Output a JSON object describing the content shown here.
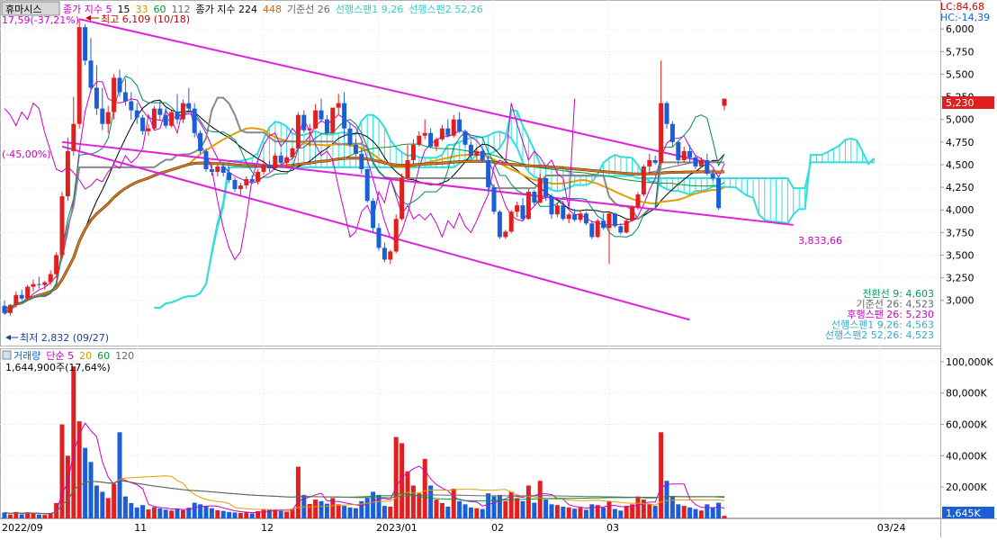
{
  "stock_name": "휴마시스",
  "header_legend": [
    {
      "text": "종가 지수 5",
      "color": "#cc00cc"
    },
    {
      "text": "15",
      "color": "#000000"
    },
    {
      "text": "33",
      "color": "#cc9900"
    },
    {
      "text": "60",
      "color": "#009933"
    },
    {
      "text": "112",
      "color": "#666666"
    },
    {
      "text": "종가 지수 224",
      "color": "#000000"
    },
    {
      "text": "448",
      "color": "#cc6600"
    },
    {
      "text": "기준선 26",
      "color": "#666666"
    },
    {
      "text": "선행스팬1 9,26",
      "color": "#33cccc"
    },
    {
      "text": "선행스팬2 52,26",
      "color": "#33cccc"
    }
  ],
  "top_left_info": "17,59(-37,21%)",
  "high_label": "최고 6,109 (10/18)",
  "low_label": "최저 2,832 (09/27)",
  "pct_label": "(-45,00%)",
  "trend_label": "3,833,66",
  "lc_label": "LC:84,68",
  "hc_label": "HC:-14,39",
  "current_price_label": "5,230",
  "current_volume_label": "1,645K",
  "ichimoku_values": [
    {
      "text": "전환선 9: 4,603",
      "color": "#009966"
    },
    {
      "text": "기준선 26: 4,523",
      "color": "#666666"
    },
    {
      "text": "후행스팬 26: 5,230",
      "color": "#cc00cc"
    },
    {
      "text": "선행스팬1 9,26: 4,563",
      "color": "#33aacc"
    },
    {
      "text": "선행스팬2 52,26: 4,523",
      "color": "#33aacc"
    }
  ],
  "volume_legend": [
    {
      "text": "거래량",
      "color": "#0066cc"
    },
    {
      "text": "단순 5",
      "color": "#cc00cc"
    },
    {
      "text": "20",
      "color": "#cc9900"
    },
    {
      "text": "60",
      "color": "#009933"
    },
    {
      "text": "120",
      "color": "#666666"
    }
  ],
  "volume_info": "1,644,900주(17,64%)",
  "colors": {
    "up": "#e02020",
    "down": "#1a5fd6",
    "cloud": "#33dddd",
    "trend": "#dd22dd"
  },
  "chart_data": {
    "type": "candlestick",
    "price_axis": {
      "ticks": [
        3000,
        3250,
        3500,
        3750,
        4000,
        4250,
        4500,
        4750,
        5000,
        5250,
        5500,
        5750,
        6000
      ],
      "tick_labels": [
        "3,000",
        "3,250",
        "3,500",
        "3,750",
        "4,000",
        "4,250",
        "4,500",
        "4,750",
        "5,000",
        "5,250",
        "5,500",
        "5,750",
        "6,000"
      ],
      "range": [
        2500,
        6300
      ]
    },
    "volume_axis": {
      "ticks": [
        20000000,
        40000000,
        60000000,
        80000000,
        100000000
      ],
      "tick_labels": [
        "20,000K",
        "40,000K",
        "60,000K",
        "80,000K",
        "100,000K"
      ],
      "range": [
        0,
        108000000
      ]
    },
    "x_axis_labels": [
      {
        "index": 0,
        "label": "2022/09"
      },
      {
        "index": 23,
        "label": "11"
      },
      {
        "index": 45,
        "label": "12"
      },
      {
        "index": 65,
        "label": "2023/01"
      },
      {
        "index": 85,
        "label": "02"
      },
      {
        "index": 105,
        "label": "03"
      },
      {
        "index": 152,
        "label": "03/24"
      }
    ],
    "bars": [
      [
        2940,
        3000,
        2840,
        2860,
        3800000
      ],
      [
        2860,
        2960,
        2832,
        2950,
        2500000
      ],
      [
        2950,
        3100,
        2920,
        3060,
        4100000
      ],
      [
        3060,
        3120,
        3000,
        3020,
        2600000
      ],
      [
        3020,
        3170,
        3000,
        3150,
        3900000
      ],
      [
        3150,
        3230,
        3100,
        3180,
        3300000
      ],
      [
        3180,
        3260,
        3130,
        3170,
        2500000
      ],
      [
        3170,
        3220,
        3120,
        3200,
        2200000
      ],
      [
        3200,
        3330,
        3170,
        3290,
        3500000
      ],
      [
        3290,
        3530,
        3250,
        3500,
        9800000
      ],
      [
        3500,
        4200,
        3470,
        4150,
        60000000
      ],
      [
        4150,
        4800,
        4100,
        4650,
        40000000
      ],
      [
        4650,
        5250,
        4600,
        4950,
        97000000
      ],
      [
        4950,
        6109,
        4900,
        6020,
        62000000
      ],
      [
        6020,
        6050,
        5600,
        5650,
        45000000
      ],
      [
        5650,
        5900,
        5300,
        5350,
        36000000
      ],
      [
        5350,
        5600,
        5050,
        5120,
        21000000
      ],
      [
        5120,
        5350,
        4880,
        4950,
        17000000
      ],
      [
        4950,
        5150,
        4850,
        5080,
        13000000
      ],
      [
        5080,
        5500,
        5000,
        5460,
        22000000
      ],
      [
        5460,
        5550,
        5250,
        5300,
        55000000
      ],
      [
        5300,
        5450,
        5150,
        5200,
        14000000
      ],
      [
        5200,
        5300,
        5000,
        5100,
        9800000
      ],
      [
        5100,
        5180,
        4950,
        5020,
        7000000
      ],
      [
        5020,
        5050,
        4830,
        4870,
        8500000
      ],
      [
        4870,
        4950,
        4820,
        4900,
        5700000
      ],
      [
        4900,
        5150,
        4880,
        5120,
        7200000
      ],
      [
        5120,
        5200,
        5000,
        5050,
        6400000
      ],
      [
        5050,
        5130,
        4900,
        4930,
        5600000
      ],
      [
        4930,
        5100,
        4910,
        5080,
        5000000
      ],
      [
        5080,
        5280,
        4950,
        5000,
        6200000
      ],
      [
        5000,
        5220,
        4960,
        5180,
        5300000
      ],
      [
        5180,
        5350,
        5070,
        5120,
        6800000
      ],
      [
        5120,
        5180,
        4800,
        4850,
        10000000
      ],
      [
        4850,
        4880,
        4620,
        4650,
        9000000
      ],
      [
        4650,
        4680,
        4420,
        4450,
        8000000
      ],
      [
        4450,
        4500,
        4380,
        4420,
        6500000
      ],
      [
        4420,
        4500,
        4370,
        4480,
        5200000
      ],
      [
        4480,
        4520,
        4370,
        4410,
        4800000
      ],
      [
        4410,
        4470,
        4300,
        4330,
        4100000
      ],
      [
        4330,
        4360,
        4200,
        4230,
        3800000
      ],
      [
        4230,
        4300,
        4160,
        4270,
        3500000
      ],
      [
        4270,
        4370,
        4230,
        4340,
        3900000
      ],
      [
        4340,
        4380,
        4290,
        4310,
        3200000
      ],
      [
        4310,
        4450,
        4280,
        4420,
        4600000
      ],
      [
        4420,
        4560,
        4390,
        4500,
        6000000
      ],
      [
        4500,
        4540,
        4420,
        4460,
        5400000
      ],
      [
        4460,
        4630,
        4450,
        4600,
        5600000
      ],
      [
        4600,
        4640,
        4500,
        4520,
        4800000
      ],
      [
        4520,
        4600,
        4470,
        4580,
        4300000
      ],
      [
        4580,
        4700,
        4560,
        4680,
        6200000
      ],
      [
        4680,
        5080,
        4660,
        5050,
        33000000
      ],
      [
        5050,
        5100,
        4850,
        4880,
        15000000
      ],
      [
        4880,
        4950,
        4700,
        4900,
        9200000
      ],
      [
        4900,
        5170,
        4890,
        5100,
        12000000
      ],
      [
        5100,
        5230,
        4970,
        5000,
        11000000
      ],
      [
        5000,
        5050,
        4830,
        4850,
        9400000
      ],
      [
        4850,
        5120,
        4840,
        5130,
        13000000
      ],
      [
        5130,
        5280,
        5050,
        5180,
        9000000
      ],
      [
        5180,
        5300,
        4800,
        4900,
        8000000
      ],
      [
        4900,
        4970,
        4700,
        4720,
        7000000
      ],
      [
        4720,
        4780,
        4600,
        4620,
        6500000
      ],
      [
        4620,
        4680,
        4400,
        4450,
        11000000
      ],
      [
        4450,
        4460,
        4080,
        4100,
        13000000
      ],
      [
        4100,
        4130,
        3750,
        3800,
        17000000
      ],
      [
        3800,
        3850,
        3550,
        3580,
        15000000
      ],
      [
        3580,
        3640,
        3420,
        3450,
        8000000
      ],
      [
        3450,
        3560,
        3400,
        3540,
        7500000
      ],
      [
        3540,
        3950,
        3520,
        3900,
        52000000
      ],
      [
        3900,
        4400,
        3880,
        4350,
        48000000
      ],
      [
        4350,
        4720,
        4330,
        4550,
        30000000
      ],
      [
        4550,
        4780,
        4510,
        4720,
        21000000
      ],
      [
        4720,
        4870,
        4700,
        4820,
        16000000
      ],
      [
        4820,
        5000,
        4780,
        4850,
        38000000
      ],
      [
        4850,
        4900,
        4680,
        4700,
        21000000
      ],
      [
        4700,
        4800,
        4650,
        4780,
        12000000
      ],
      [
        4780,
        4940,
        4760,
        4900,
        9800000
      ],
      [
        4900,
        5000,
        4800,
        4820,
        7500000
      ],
      [
        4820,
        5050,
        4800,
        5000,
        19000000
      ],
      [
        5000,
        5080,
        4850,
        4870,
        11000000
      ],
      [
        4870,
        4890,
        4700,
        4720,
        9000000
      ],
      [
        4720,
        4750,
        4570,
        4600,
        7000000
      ],
      [
        4600,
        4670,
        4550,
        4650,
        6500000
      ],
      [
        4650,
        4680,
        4520,
        4550,
        6000000
      ],
      [
        4550,
        4600,
        4200,
        4250,
        16000000
      ],
      [
        4250,
        4280,
        3950,
        3980,
        14000000
      ],
      [
        3980,
        4000,
        3680,
        3700,
        15000000
      ],
      [
        3700,
        3780,
        3680,
        3760,
        11000000
      ],
      [
        3760,
        4000,
        3740,
        3980,
        17000000
      ],
      [
        3980,
        4090,
        3920,
        4050,
        13000000
      ],
      [
        4050,
        4130,
        3880,
        3900,
        11000000
      ],
      [
        3900,
        4230,
        3890,
        4200,
        21000000
      ],
      [
        4200,
        4220,
        4050,
        4080,
        10000000
      ],
      [
        4080,
        4400,
        4070,
        4350,
        24000000
      ],
      [
        4350,
        4360,
        4100,
        4150,
        12000000
      ],
      [
        4150,
        4180,
        3900,
        3950,
        9000000
      ],
      [
        3950,
        4080,
        3920,
        4050,
        8500000
      ],
      [
        4050,
        4100,
        3880,
        3900,
        7500000
      ],
      [
        3900,
        3970,
        3850,
        3950,
        7000000
      ],
      [
        3950,
        4010,
        3870,
        3890,
        6200000
      ],
      [
        3890,
        4000,
        3860,
        3960,
        6800000
      ],
      [
        3960,
        3980,
        3830,
        3850,
        5500000
      ],
      [
        3850,
        3880,
        3680,
        3700,
        9000000
      ],
      [
        3700,
        3900,
        3690,
        3880,
        8500000
      ],
      [
        3880,
        3960,
        3780,
        3800,
        7000000
      ],
      [
        3800,
        3980,
        3400,
        3960,
        11000000
      ],
      [
        3960,
        3970,
        3800,
        3820,
        6000000
      ],
      [
        3820,
        3850,
        3730,
        3750,
        5000000
      ],
      [
        3750,
        3900,
        3740,
        3880,
        8000000
      ],
      [
        3880,
        4050,
        3870,
        4030,
        9000000
      ],
      [
        4030,
        4200,
        4000,
        4170,
        14000000
      ],
      [
        4170,
        4500,
        4150,
        4480,
        12000000
      ],
      [
        4480,
        4620,
        4400,
        4550,
        9000000
      ],
      [
        4550,
        4600,
        4500,
        4520,
        8000000
      ],
      [
        4520,
        5650,
        4500,
        5180,
        55000000
      ],
      [
        5180,
        5200,
        4900,
        4950,
        24000000
      ],
      [
        4950,
        4980,
        4700,
        4750,
        14000000
      ],
      [
        4750,
        4760,
        4500,
        4550,
        9000000
      ],
      [
        4550,
        4700,
        4520,
        4650,
        8000000
      ],
      [
        4650,
        4720,
        4520,
        4580,
        7000000
      ],
      [
        4580,
        4600,
        4450,
        4480,
        6000000
      ],
      [
        4480,
        4580,
        4470,
        4550,
        5000000
      ],
      [
        4550,
        4620,
        4380,
        4400,
        9000000
      ],
      [
        4400,
        4450,
        4320,
        4350,
        7000000
      ],
      [
        4350,
        4360,
        4000,
        4020,
        10000000
      ],
      [
        5150,
        5230,
        5100,
        5230,
        1645000
      ]
    ]
  }
}
